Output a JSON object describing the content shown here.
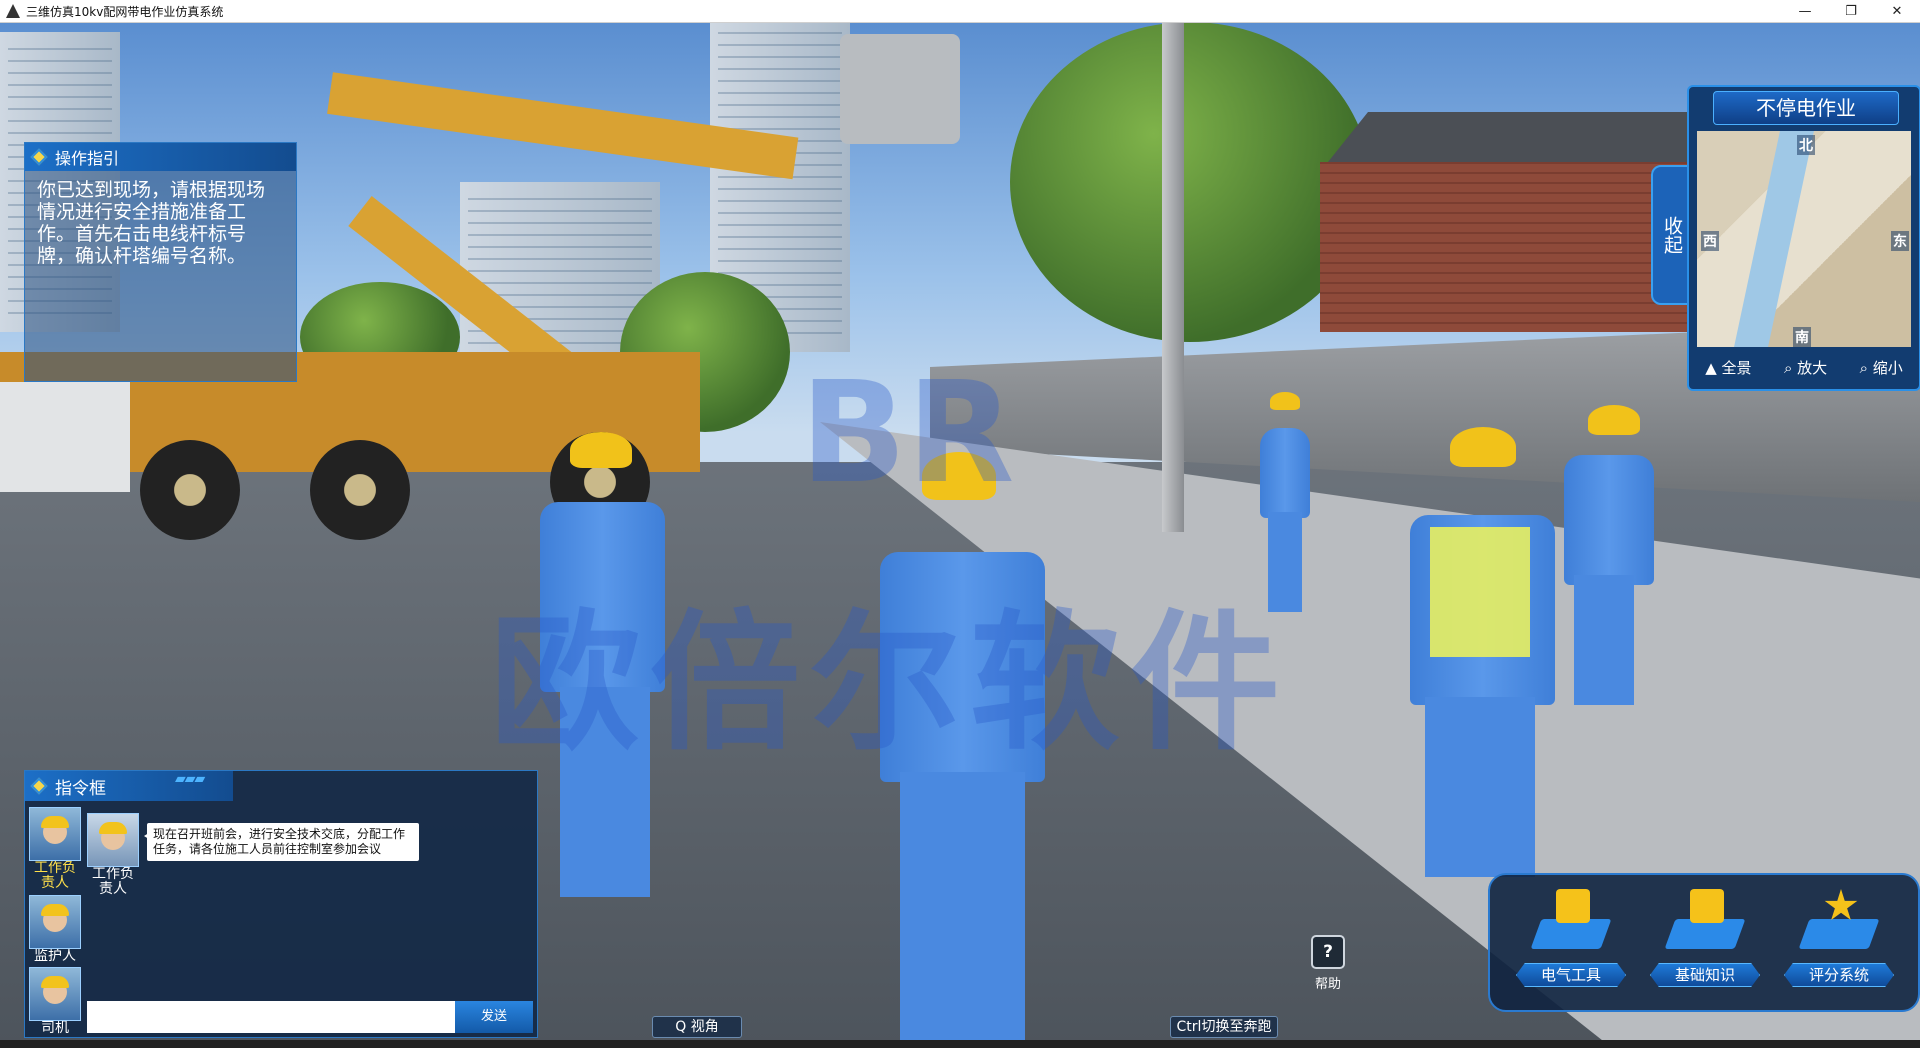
{
  "window": {
    "title": "三维仿真10kv配网带电作业仿真系统",
    "minimize": "—",
    "maximize": "❐",
    "close": "✕"
  },
  "watermark": {
    "logo": "BR",
    "text": "欧倍尔软件"
  },
  "guide": {
    "title": "操作指引",
    "text": "你已达到现场，请根据现场情况进行安全措施准备工作。首先右击电线杆标号牌，确认杆塔编号名称。"
  },
  "minimap": {
    "title": "不停电作业",
    "collapse_label": "收起",
    "directions": {
      "north": "北",
      "south": "南",
      "west": "西",
      "east": "东"
    },
    "buttons": {
      "overview": "全景",
      "zoom_in": "放大",
      "zoom_out": "缩小"
    }
  },
  "command": {
    "title": "指令框",
    "roles": [
      {
        "label": "工作负责人",
        "active": true
      },
      {
        "label": "监护人",
        "active": false
      },
      {
        "label": "司机",
        "active": false
      }
    ],
    "speaker": "工作负责人",
    "message": "现在召开班前会，进行安全技术交底，分配工作任务，请各位施工人员前往控制室参加会议",
    "input_value": "",
    "send_label": "发送"
  },
  "hints": {
    "view": "Q   视角",
    "run": "Ctrl切换至奔跑",
    "help": "帮助",
    "help_glyph": "?"
  },
  "dock": {
    "tools": [
      {
        "label": "电气工具",
        "icon": "toolbox-icon"
      },
      {
        "label": "基础知识",
        "icon": "book-icon"
      },
      {
        "label": "评分系统",
        "icon": "star-icon"
      }
    ]
  },
  "colors": {
    "panel_blue": "#1c6fc7",
    "helmet_yellow": "#f1c21a",
    "uniform_blue": "#4a89e0"
  }
}
